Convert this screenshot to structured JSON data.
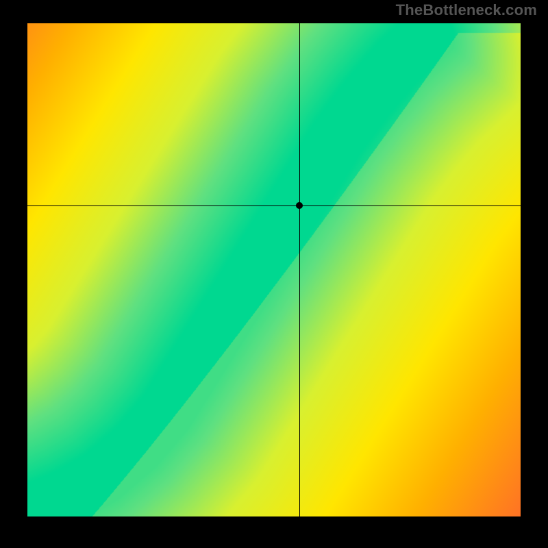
{
  "watermark": "TheBottleneck.com",
  "chart_data": {
    "type": "heatmap",
    "title": "",
    "xlabel": "",
    "ylabel": "",
    "xlim": [
      0,
      1
    ],
    "ylim": [
      0,
      1
    ],
    "grid": false,
    "legend": false,
    "crosshair": {
      "x": 0.552,
      "y": 0.63
    },
    "marker": {
      "x": 0.552,
      "y": 0.63
    },
    "colormap": {
      "stops": [
        [
          0.0,
          "#ff1a44"
        ],
        [
          0.25,
          "#ff6a2a"
        ],
        [
          0.45,
          "#ffb000"
        ],
        [
          0.6,
          "#ffe600"
        ],
        [
          0.75,
          "#d8f030"
        ],
        [
          0.88,
          "#60e080"
        ],
        [
          1.0,
          "#00d890"
        ]
      ]
    },
    "ridge": {
      "comment": "Approximate centerline of the green optimal band as (x, y) control points in [0,1]^2, origin bottom-left.",
      "points": [
        [
          0.02,
          0.015
        ],
        [
          0.08,
          0.04
        ],
        [
          0.15,
          0.08
        ],
        [
          0.22,
          0.14
        ],
        [
          0.28,
          0.21
        ],
        [
          0.33,
          0.29
        ],
        [
          0.38,
          0.37
        ],
        [
          0.43,
          0.45
        ],
        [
          0.48,
          0.53
        ],
        [
          0.53,
          0.61
        ],
        [
          0.58,
          0.69
        ],
        [
          0.63,
          0.77
        ],
        [
          0.69,
          0.85
        ],
        [
          0.75,
          0.92
        ],
        [
          0.82,
          0.985
        ]
      ],
      "core_width": 0.055,
      "falloff": 0.95
    }
  }
}
